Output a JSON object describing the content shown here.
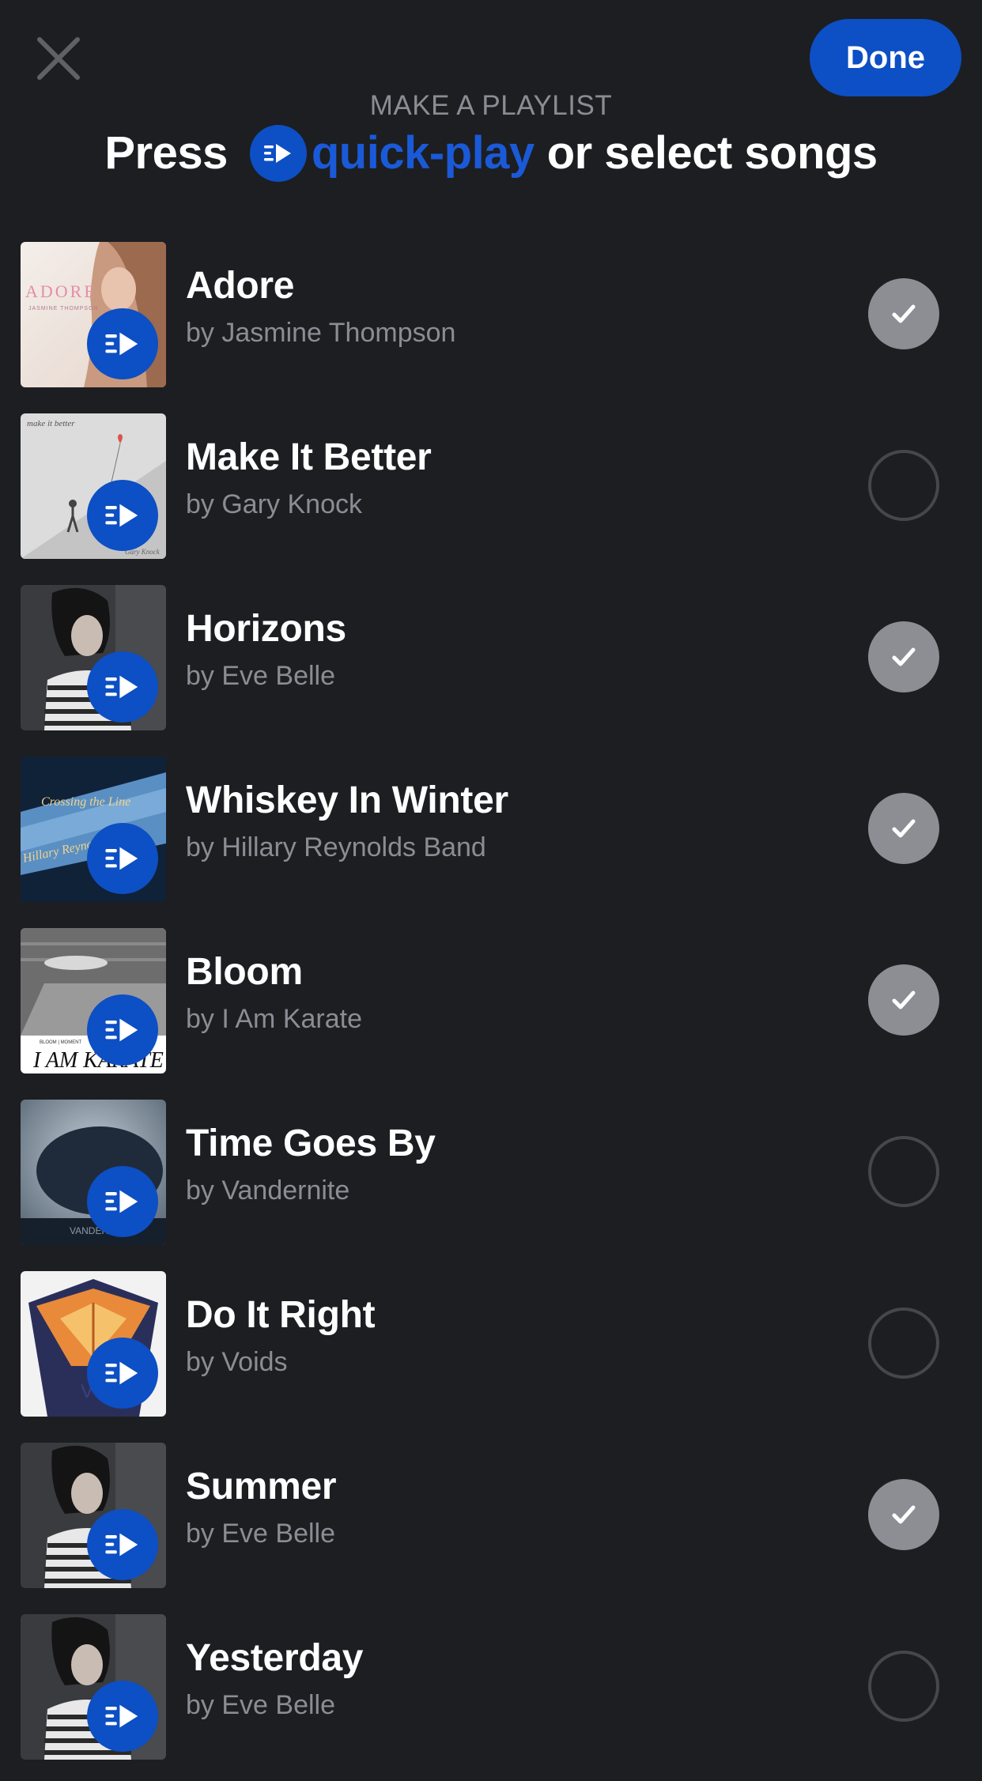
{
  "header": {
    "close_icon": "close-icon",
    "done_label": "Done",
    "subtitle": "MAKE A PLAYLIST",
    "headline_prefix": "Press",
    "headline_accent": "quick-play",
    "headline_suffix": "or select songs",
    "accent_color": "#0d4fc4"
  },
  "songs": [
    {
      "title": "Adore",
      "artist": "by Jasmine Thompson",
      "selected": true
    },
    {
      "title": "Make It Better",
      "artist": "by Gary Knock",
      "selected": false
    },
    {
      "title": "Horizons",
      "artist": "by Eve Belle",
      "selected": true
    },
    {
      "title": "Whiskey In Winter",
      "artist": "by Hillary Reynolds Band",
      "selected": true
    },
    {
      "title": "Bloom",
      "artist": "by I Am Karate",
      "selected": true
    },
    {
      "title": "Time Goes By",
      "artist": "by Vandernite",
      "selected": false
    },
    {
      "title": "Do It Right",
      "artist": "by Voids",
      "selected": false
    },
    {
      "title": "Summer",
      "artist": "by Eve Belle",
      "selected": true
    },
    {
      "title": "Yesterday",
      "artist": "by Eve Belle",
      "selected": false
    }
  ]
}
